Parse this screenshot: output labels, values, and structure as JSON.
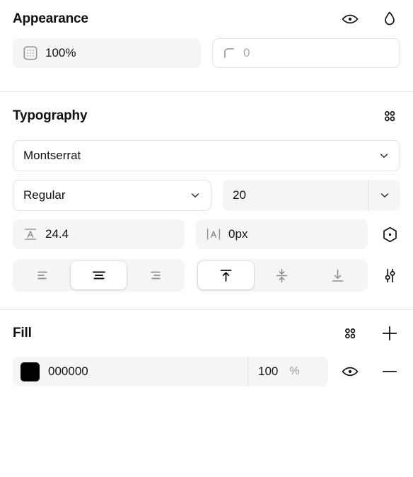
{
  "appearance": {
    "title": "Appearance",
    "visibility_icon": "eye-icon",
    "blend_icon": "droplet-icon",
    "opacity": {
      "icon": "opacity-grid-icon",
      "value": "100%"
    },
    "corner_radius": {
      "icon": "corner-radius-icon",
      "value": "",
      "placeholder": "0"
    }
  },
  "typography": {
    "title": "Typography",
    "styles_icon": "four-dots-icon",
    "font_family": {
      "value": "Montserrat",
      "chevron": "chevron-down-icon"
    },
    "font_weight": {
      "value": "Regular",
      "chevron": "chevron-down-icon"
    },
    "font_size": {
      "value": "20",
      "chevron": "chevron-down-icon"
    },
    "line_height": {
      "icon": "line-height-icon",
      "value": "24.4"
    },
    "letter_spacing": {
      "icon": "letter-spacing-icon",
      "value": "0px"
    },
    "decoration_icon": "hexagon-dot-icon",
    "horizontal_align": {
      "options": [
        "align-left-icon",
        "align-center-icon",
        "align-right-icon"
      ],
      "selected_index": 1
    },
    "vertical_align": {
      "options": [
        "align-top-icon",
        "align-middle-icon",
        "align-bottom-icon"
      ],
      "selected_index": 0
    },
    "settings_icon": "sliders-icon"
  },
  "fill": {
    "title": "Fill",
    "styles_icon": "four-dots-icon",
    "add_icon": "plus-icon",
    "items": [
      {
        "color": "#000000",
        "hex": "000000",
        "opacity": "100",
        "opacity_unit": "%",
        "visibility_icon": "eye-icon",
        "remove_icon": "minus-icon"
      }
    ]
  },
  "colors": {
    "field_bg": "#f5f5f5",
    "border": "#e2e2e2",
    "divider": "#e8e8e8",
    "text": "#111111",
    "muted": "#a8a8a8"
  }
}
